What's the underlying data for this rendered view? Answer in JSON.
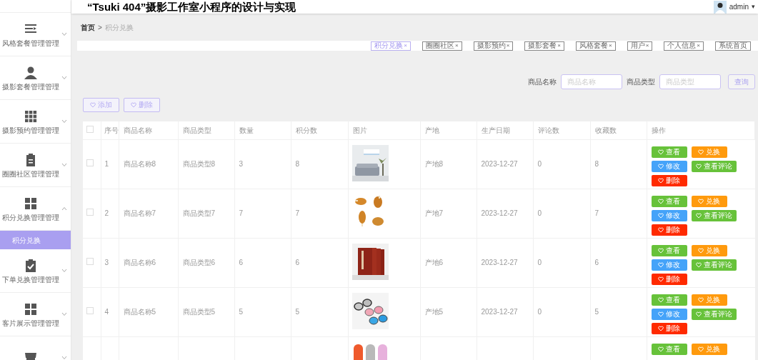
{
  "header": {
    "title": "“Tsuki 404”摄影工作室小程序的设计与实现",
    "user": "admin",
    "caret": "▾"
  },
  "sidebar": {
    "items": [
      {
        "label": "风格套餐管理管理",
        "expanded": false
      },
      {
        "label": "摄影套餐管理管理",
        "expanded": false
      },
      {
        "label": "摄影预约管理管理",
        "expanded": false
      },
      {
        "label": "圈圈社区管理管理",
        "expanded": false
      },
      {
        "label": "积分兑换管理管理",
        "expanded": true,
        "children": [
          {
            "label": "积分兑换",
            "selected": true
          }
        ]
      },
      {
        "label": "下单兑换管理管理",
        "expanded": false
      },
      {
        "label": "客片展示管理管理",
        "expanded": false
      },
      {
        "expanded": false
      }
    ]
  },
  "breadcrumb": {
    "items": [
      "首页",
      "积分兑换"
    ],
    "separator": ">"
  },
  "tabs": [
    {
      "label": "积分兑换",
      "close": "×",
      "selected": true
    },
    {
      "label": "圈圈社区",
      "close": "×",
      "selected": false
    },
    {
      "label": "摄影预约",
      "close": "×",
      "selected": false
    },
    {
      "label": "摄影套餐",
      "close": "×",
      "selected": false
    },
    {
      "label": "风格套餐",
      "close": "×",
      "selected": false
    },
    {
      "label": "用户",
      "close": "×",
      "selected": false
    },
    {
      "label": "个人信息",
      "close": "×",
      "selected": false
    },
    {
      "label": "系统首页",
      "selected": false
    }
  ],
  "search": {
    "fields": [
      {
        "label": "商品名称",
        "placeholder": "商品名称"
      },
      {
        "label": "商品类型",
        "placeholder": "商品类型"
      }
    ],
    "button": "查询"
  },
  "toolbar": [
    "添加",
    "删除"
  ],
  "table": {
    "select_all_checked": false,
    "columns": [
      "序号",
      "商品名称",
      "商品类型",
      "数量",
      "积分数",
      "图片",
      "产地",
      "生产日期",
      "评论数",
      "收藏数",
      "操作"
    ],
    "rows": [
      {
        "checked": false,
        "cells": [
          "1",
          "商品名称8",
          "商品类型8",
          "3",
          "8",
          null,
          "产地8",
          "2023-12-27",
          "0",
          "8"
        ],
        "actions": [
          {
            "label": "查看",
            "kind": "view"
          },
          {
            "label": "兑换",
            "kind": "exchange"
          },
          {
            "label": "修改",
            "kind": "edit"
          },
          {
            "label": "查看评论",
            "kind": "comments"
          },
          {
            "label": "删除",
            "kind": "delete"
          }
        ]
      },
      {
        "checked": false,
        "cells": [
          "2",
          "商品名称7",
          "商品类型7",
          "7",
          "7",
          null,
          "产地7",
          "2023-12-27",
          "0",
          "7"
        ],
        "actions": [
          {
            "label": "查看",
            "kind": "view"
          },
          {
            "label": "兑换",
            "kind": "exchange"
          },
          {
            "label": "修改",
            "kind": "edit"
          },
          {
            "label": "查看评论",
            "kind": "comments"
          },
          {
            "label": "删除",
            "kind": "delete"
          }
        ]
      },
      {
        "checked": false,
        "cells": [
          "3",
          "商品名称6",
          "商品类型6",
          "6",
          "6",
          null,
          "产地6",
          "2023-12-27",
          "0",
          "6"
        ],
        "actions": [
          {
            "label": "查看",
            "kind": "view"
          },
          {
            "label": "兑换",
            "kind": "exchange"
          },
          {
            "label": "修改",
            "kind": "edit"
          },
          {
            "label": "查看评论",
            "kind": "comments"
          },
          {
            "label": "删除",
            "kind": "delete"
          }
        ]
      },
      {
        "checked": false,
        "cells": [
          "4",
          "商品名称5",
          "商品类型5",
          "5",
          "5",
          null,
          "产地5",
          "2023-12-27",
          "0",
          "5"
        ],
        "actions": [
          {
            "label": "查看",
            "kind": "view"
          },
          {
            "label": "兑换",
            "kind": "exchange"
          },
          {
            "label": "修改",
            "kind": "edit"
          },
          {
            "label": "查看评论",
            "kind": "comments"
          },
          {
            "label": "删除",
            "kind": "delete"
          }
        ]
      },
      {
        "actions": [
          {
            "label": "查看",
            "kind": "view"
          },
          {
            "label": "兑换",
            "kind": "exchange"
          }
        ]
      }
    ]
  }
}
